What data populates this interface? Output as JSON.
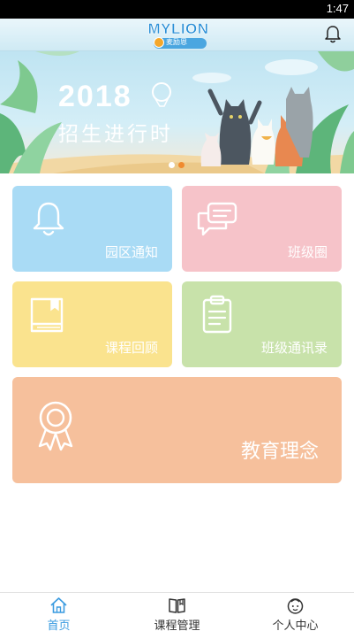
{
  "status_bar": {
    "time": "1:47"
  },
  "header": {
    "logo_text": "MYLION",
    "logo_sub": "麦励恩"
  },
  "banner": {
    "year": "2018",
    "slogan": "招生进行时",
    "page_count": 2,
    "active_page": 2
  },
  "tiles": [
    {
      "label": "园区通知",
      "icon": "bell-icon",
      "color": "#a9dbf5"
    },
    {
      "label": "班级圈",
      "icon": "chat-bubbles-icon",
      "color": "#f6c3c9"
    },
    {
      "label": "课程回顾",
      "icon": "book-icon",
      "color": "#fae38e"
    },
    {
      "label": "班级通讯录",
      "icon": "clipboard-icon",
      "color": "#c8e2aa"
    },
    {
      "label": "教育理念",
      "icon": "ribbon-badge-icon",
      "color": "#f6c09c"
    }
  ],
  "tabbar": {
    "accent_color": "#3a9be0",
    "items": [
      {
        "label": "首页",
        "icon": "home-icon",
        "active": true
      },
      {
        "label": "课程管理",
        "icon": "book-open-icon",
        "active": false
      },
      {
        "label": "个人中心",
        "icon": "face-icon",
        "active": false
      }
    ]
  }
}
